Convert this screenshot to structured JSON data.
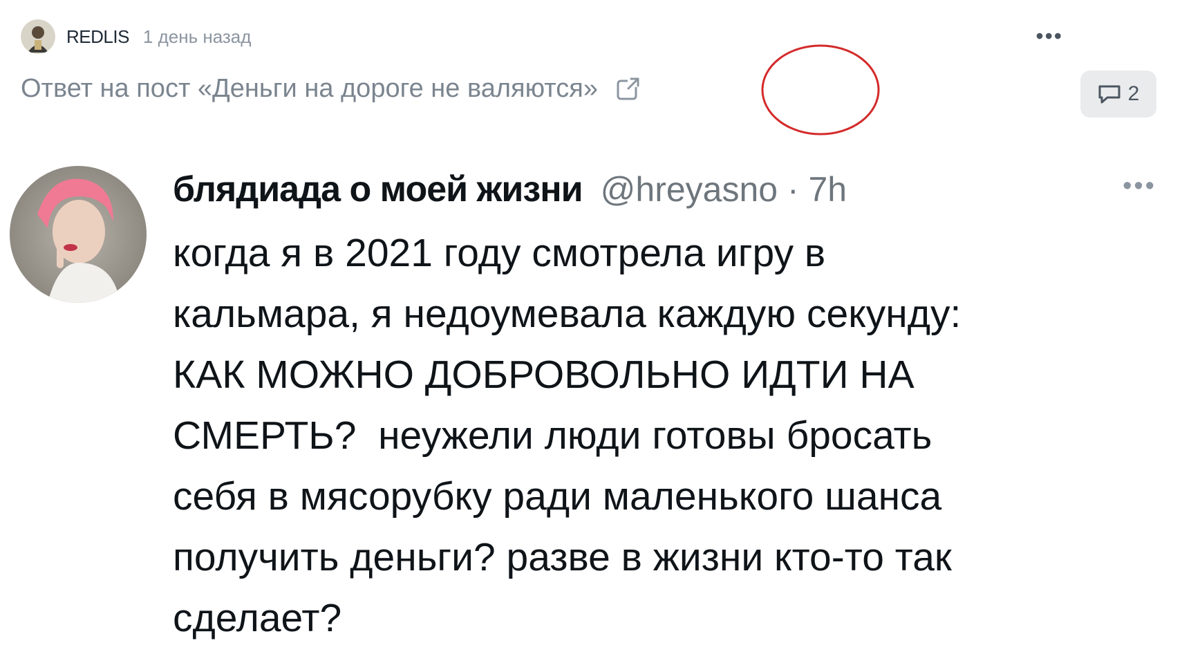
{
  "post": {
    "author": "REDLIS",
    "time": "1 день назад",
    "reply_text": "Ответ на пост «Деньги на дороге не валяются»",
    "comments_count": "2"
  },
  "tweet": {
    "name": "блядиада о моей жизни",
    "handle_time": "@hreyasno · 7h",
    "text_lines": [
      "когда я в 2021 году смотрела игру в",
      "кальмара, я недоумевала каждую секунду:",
      "КАК МОЖНО ДОБРОВОЛЬНО ИДТИ НА",
      "СМЕРТЬ?  неужели люди готовы бросать",
      "себя в мясорубку ради маленького шанса",
      "получить деньги? разве в жизни кто-то так",
      "сделает?"
    ]
  },
  "icons": {
    "more": "more-dots-icon",
    "external": "external-link-icon",
    "comments": "comment-icon"
  },
  "colors": {
    "annotation_circle": "#d42a2a",
    "muted_text": "#7b858f"
  }
}
